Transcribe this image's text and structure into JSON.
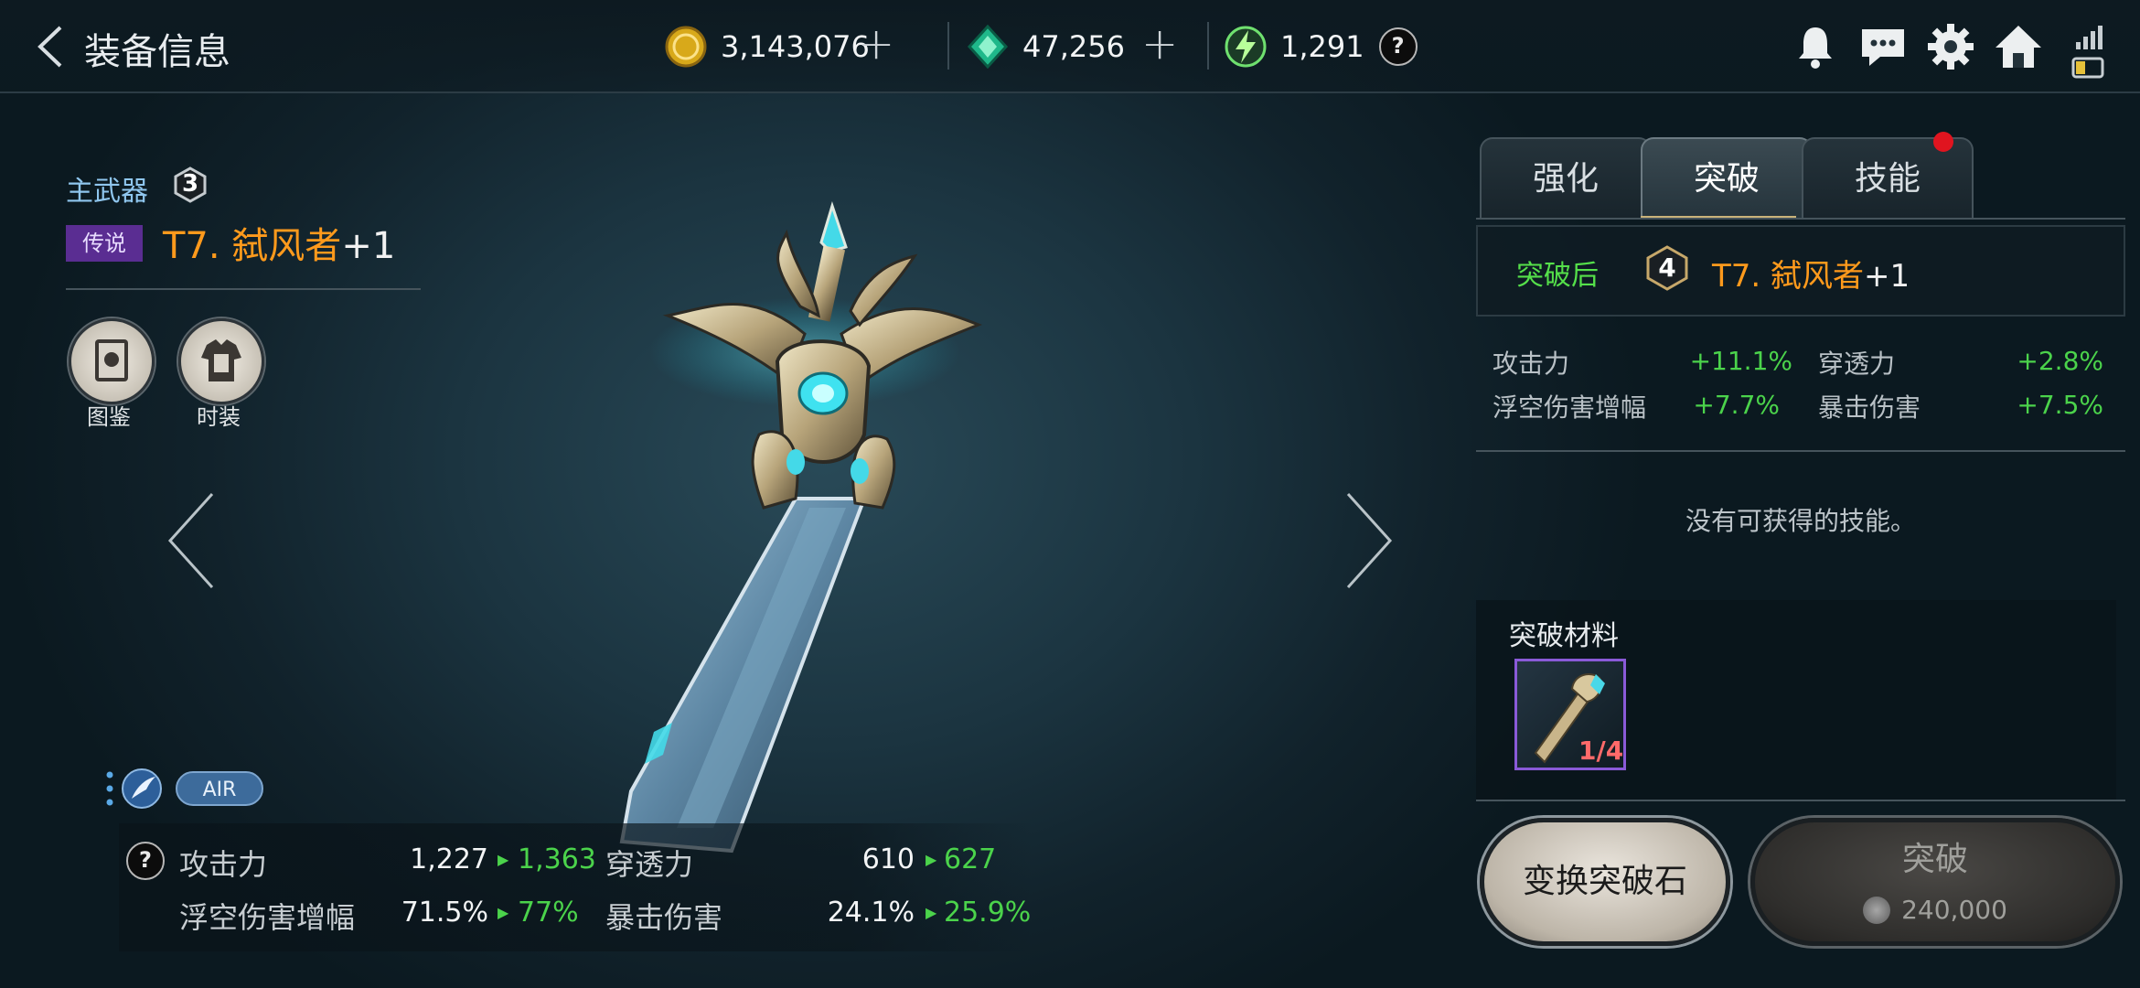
{
  "header": {
    "title": "装备信息",
    "currencies": [
      {
        "icon": "gold-coin-icon",
        "amount": "3,143,076"
      },
      {
        "icon": "green-gem-icon",
        "amount": "47,256"
      },
      {
        "icon": "lightning-stone-icon",
        "amount": "1,291"
      }
    ],
    "help_label": "?",
    "right_icons": [
      "bell-icon",
      "chat-icon",
      "gear-icon",
      "home-icon",
      "signal-battery-icon"
    ]
  },
  "equipment": {
    "slot_label": "主武器",
    "slot_level": "3",
    "rarity": "传说",
    "name": "T7. 弑风者",
    "enhance": "+1",
    "buttons": [
      {
        "label": "图鉴",
        "icon": "book-icon"
      },
      {
        "label": "时装",
        "icon": "armor-icon"
      }
    ],
    "attribute_tag": "AIR"
  },
  "stats": {
    "help_label": "?",
    "rows": [
      {
        "name": "攻击力",
        "current": "1,227",
        "next": "1,363"
      },
      {
        "name": "穿透力",
        "current": "610",
        "next": "627"
      },
      {
        "name": "浮空伤害增幅",
        "current": "71.5%",
        "next": "77%"
      },
      {
        "name": "暴击伤害",
        "current": "24.1%",
        "next": "25.9%"
      }
    ]
  },
  "panel": {
    "tabs": [
      "强化",
      "突破",
      "技能"
    ],
    "active_tab": "突破",
    "after_label": "突破后",
    "after_level": "4",
    "after_name": "T7. 弑风者",
    "after_enhance": "+1",
    "increases": [
      {
        "name": "攻击力",
        "value": "+11.1%"
      },
      {
        "name": "穿透力",
        "value": "+2.8%"
      },
      {
        "name": "浮空伤害增幅",
        "value": "+7.7%"
      },
      {
        "name": "暴击伤害",
        "value": "+7.5%"
      }
    ],
    "no_skill_text": "没有可获得的技能。",
    "materials_title": "突破材料",
    "material_count": "1/4",
    "convert_button": "变换突破石",
    "breakthrough_button": "突破",
    "breakthrough_cost": "240,000"
  },
  "colors": {
    "legend_orange": "#ff9a1c",
    "increase_green": "#4bd34b",
    "rarity_purple": "#5a2d92"
  }
}
